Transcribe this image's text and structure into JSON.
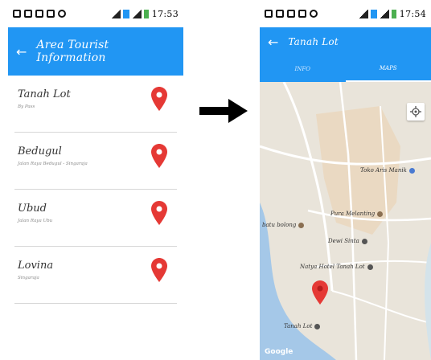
{
  "left_screen": {
    "status_time": "17:53",
    "title": "Area Tourist Information",
    "items": [
      {
        "name": "Tanah Lot",
        "address": "By Pass"
      },
      {
        "name": "Bedugul",
        "address": "Jalan Raya Bedugul - Singaraja"
      },
      {
        "name": "Ubud",
        "address": "Jalan Raya Ubu"
      },
      {
        "name": "Lovina",
        "address": "Singaraja"
      }
    ]
  },
  "right_screen": {
    "status_time": "17:54",
    "title": "Tanah Lot",
    "tabs": [
      {
        "label": "INFO",
        "active": false
      },
      {
        "label": "MAPS",
        "active": true
      }
    ],
    "map": {
      "labels": {
        "toko": "Toko Aris Manik",
        "pura": "Pura Melanting",
        "batu": "batu bolong",
        "dewi": "Dewi Sinta",
        "natya": "Natya Hotel Tanah Lot",
        "tanah": "Tanah Lot"
      },
      "watermark": "Google"
    }
  },
  "colors": {
    "primary": "#2196f3",
    "pin": "#e53935",
    "water": "#a5c8e8",
    "map_land": "#e9e4da",
    "map_area": "#ead9c2"
  },
  "icons": {
    "back": "back-arrow-icon",
    "pin": "map-pin-icon",
    "transition": "right-arrow-icon",
    "gps": "my-location-icon"
  }
}
